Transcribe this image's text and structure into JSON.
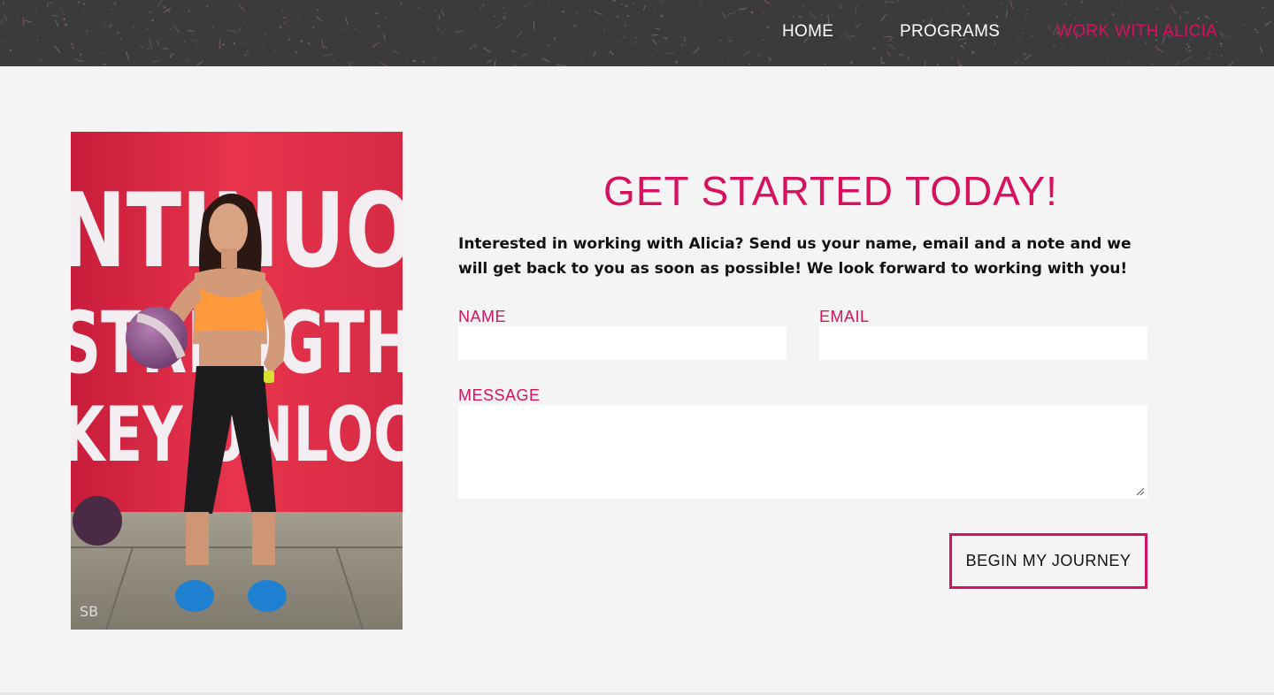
{
  "colors": {
    "accent": "#d6125f",
    "header_bg": "#3b3a3c",
    "page_bg": "#f4f4f4"
  },
  "nav": {
    "items": [
      {
        "label": "HOME",
        "active": false
      },
      {
        "label": "PROGRAMS",
        "active": false
      },
      {
        "label": "WORK WITH ALICIA",
        "active": true
      }
    ]
  },
  "hero_image": {
    "wall_text": [
      "NTINUO",
      "STRENGTH",
      "KEY UNLOC"
    ],
    "watermark": "SB"
  },
  "form": {
    "headline": "GET STARTED TODAY!",
    "intro": "Interested in working with Alicia? Send us your name, email and a note and we will get back to you as soon as possible! We look forward to working with you!",
    "name_label": "NAME",
    "name_value": "",
    "email_label": "EMAIL",
    "email_value": "",
    "message_label": "MESSAGE",
    "message_value": "",
    "submit_label": "BEGIN MY JOURNEY"
  }
}
